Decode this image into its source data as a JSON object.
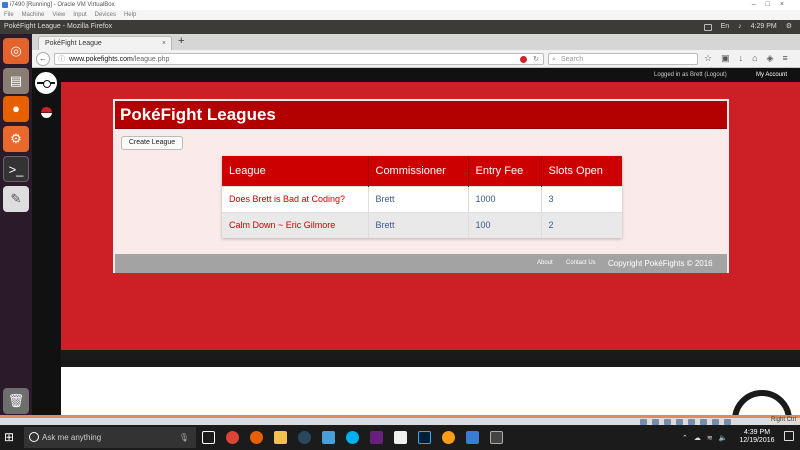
{
  "vbox": {
    "title": "i7490 [Running] - Oracle VM VirtualBox",
    "menu": [
      "File",
      "Machine",
      "View",
      "Input",
      "Devices",
      "Help"
    ],
    "status_hostkey": "Right Ctrl"
  },
  "ubuntu_panel": {
    "app_title": "PokéFight League - Mozilla Firefox",
    "keyboard_layout": "En",
    "time": "4:29 PM"
  },
  "firefox": {
    "tab_title": "PokéFight League",
    "tab_close": "×",
    "new_tab": "+",
    "back": "←",
    "url_domain": "www.pokefights.com",
    "url_path": "/league.php",
    "search_placeholder": "Search"
  },
  "site": {
    "logged_in_text": "Logged in as Brett (Logout)",
    "my_account": "My Account",
    "page_title": "PokéFight Leagues",
    "create_button": "Create League",
    "table": {
      "headers": [
        "League",
        "Commissioner",
        "Entry Fee",
        "Slots Open"
      ],
      "rows": [
        [
          "Does Brett is Bad at Coding?",
          "Brett",
          "1000",
          "3"
        ],
        [
          "Calm Down ~ Eric Gilmore",
          "Brett",
          "100",
          "2"
        ]
      ]
    },
    "footer": {
      "about": "About",
      "contact": "Contact Us",
      "copyright": "Copyright PokéFights © 2016"
    }
  },
  "taskbar": {
    "search_placeholder": "Ask me anything",
    "time": "4:39 PM",
    "date": "12/19/2016"
  },
  "colors": {
    "brand_red": "#cc1f26",
    "header_red": "#b30000",
    "link_blue": "#3a5a8a"
  },
  "icons": {
    "launcher": [
      "ubuntu-dash-icon",
      "files-icon",
      "firefox-icon",
      "settings-icon",
      "terminal-icon",
      "text-editor-icon",
      "trash-icon"
    ],
    "taskbar_apps": [
      "task-view-icon",
      "chrome-icon",
      "firefox-icon",
      "file-explorer-icon",
      "steam-icon",
      "store-icon",
      "skype-icon",
      "visual-studio-icon",
      "paint-icon",
      "photoshop-icon",
      "overwatch-icon",
      "virtualbox-icon",
      "terminal-icon"
    ]
  }
}
